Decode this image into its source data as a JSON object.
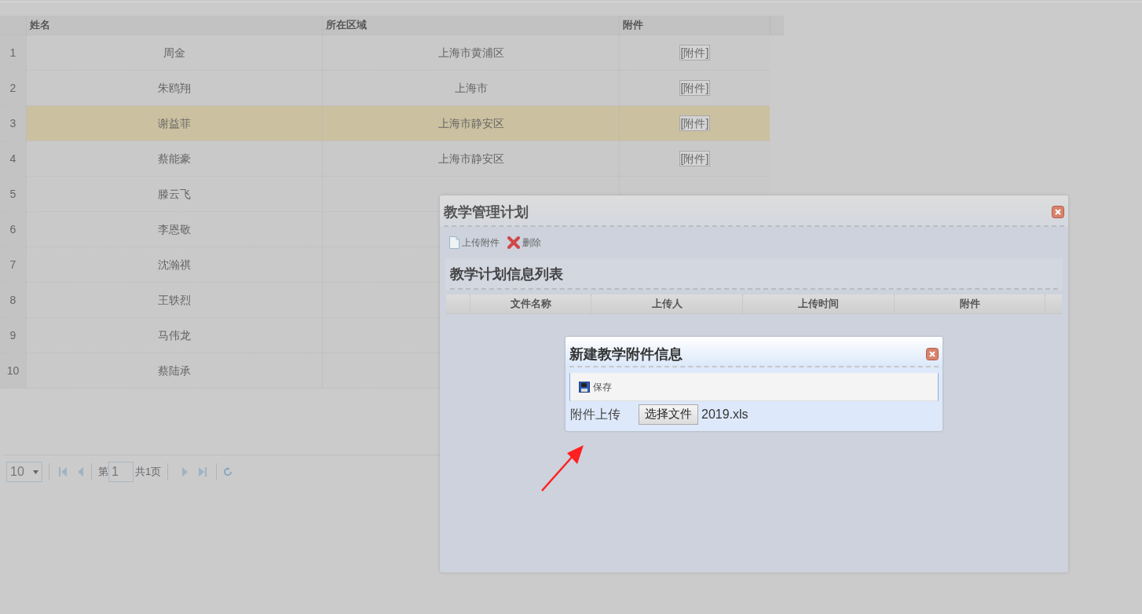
{
  "grid": {
    "columns": [
      {
        "label": "姓名"
      },
      {
        "label": "所在区域"
      },
      {
        "label": "附件"
      }
    ],
    "rows": [
      {
        "number": "1",
        "name": "周金",
        "region": "上海市黄浦区",
        "attachment": "[附件]",
        "selected": false
      },
      {
        "number": "2",
        "name": "朱鸥翔",
        "region": "上海市",
        "attachment": "[附件]",
        "selected": false
      },
      {
        "number": "3",
        "name": "谢益菲",
        "region": "上海市静安区",
        "attachment": "[附件]",
        "selected": true
      },
      {
        "number": "4",
        "name": "蔡能豪",
        "region": "上海市静安区",
        "attachment": "[附件]",
        "selected": false
      },
      {
        "number": "5",
        "name": "滕云飞",
        "selected": false
      },
      {
        "number": "6",
        "name": "李恩敬",
        "selected": false
      },
      {
        "number": "7",
        "name": "沈瀚祺",
        "selected": false
      },
      {
        "number": "8",
        "name": "王轶烈",
        "selected": false
      },
      {
        "number": "9",
        "name": "马伟龙",
        "selected": false
      },
      {
        "number": "10",
        "name": "蔡陆承",
        "selected": false
      }
    ],
    "pager": {
      "page_size": "10",
      "page_prefix": "第",
      "page": "1",
      "total": "共1页"
    }
  },
  "dialog": {
    "title": "教学管理计划",
    "toolbar": [
      {
        "kind": "upload",
        "label": "上传附件"
      },
      {
        "kind": "delete",
        "label": "删除"
      }
    ],
    "panel_title": "教学计划信息列表",
    "columns": [
      {
        "label": "文件名称"
      },
      {
        "label": "上传人"
      },
      {
        "label": "上传时间"
      },
      {
        "label": "附件"
      }
    ],
    "subdialog": {
      "title": "新建教学附件信息",
      "save_label": "保存",
      "field_label": "附件上传",
      "file_button": "选择文件",
      "file_name": "2019.xls"
    }
  }
}
